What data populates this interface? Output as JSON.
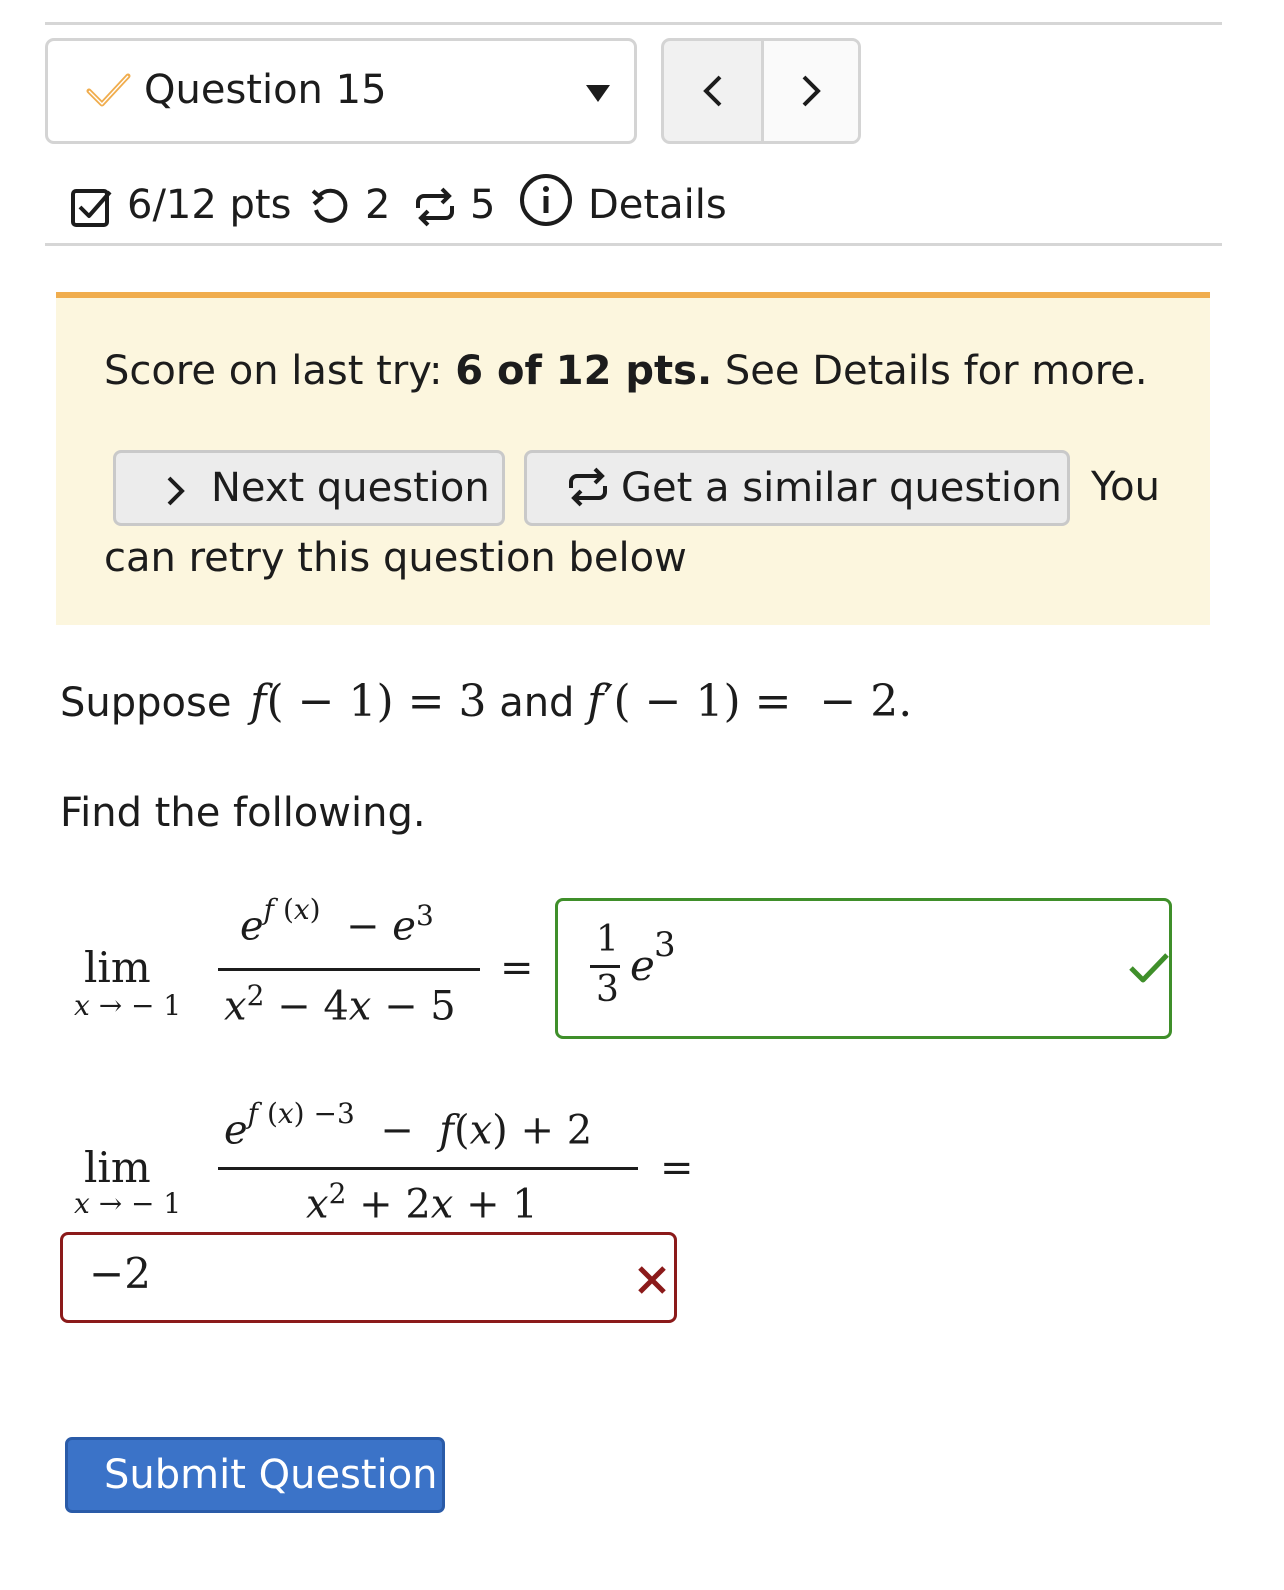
{
  "header": {
    "question_label": "Question 15",
    "prev_label": "<",
    "next_label": ">"
  },
  "stats": {
    "points": "6/12 pts",
    "retries": "2",
    "versions": "5",
    "details": "Details"
  },
  "alert": {
    "prefix": "Score on last try: ",
    "score": "6 of 12 pts.",
    "suffix": " See Details for more.",
    "next_button": "Next question",
    "similar_button": "Get a similar question",
    "you": "You",
    "retry_text": "can retry this question below"
  },
  "question": {
    "suppose_word": "Suppose",
    "and_word": "and",
    "find": "Find the following."
  },
  "part1": {
    "answer": "1/3 e^3",
    "status": "correct"
  },
  "part2": {
    "answer": "−2",
    "status": "incorrect"
  },
  "submit_label": "Submit Question",
  "colors": {
    "accent": "#3b73c8",
    "alert_bg": "#fcf6de",
    "alert_border": "#f0ad4e",
    "correct": "#3f8f2a",
    "incorrect": "#8b1a1a",
    "check_icon": "#f0ad4e"
  }
}
